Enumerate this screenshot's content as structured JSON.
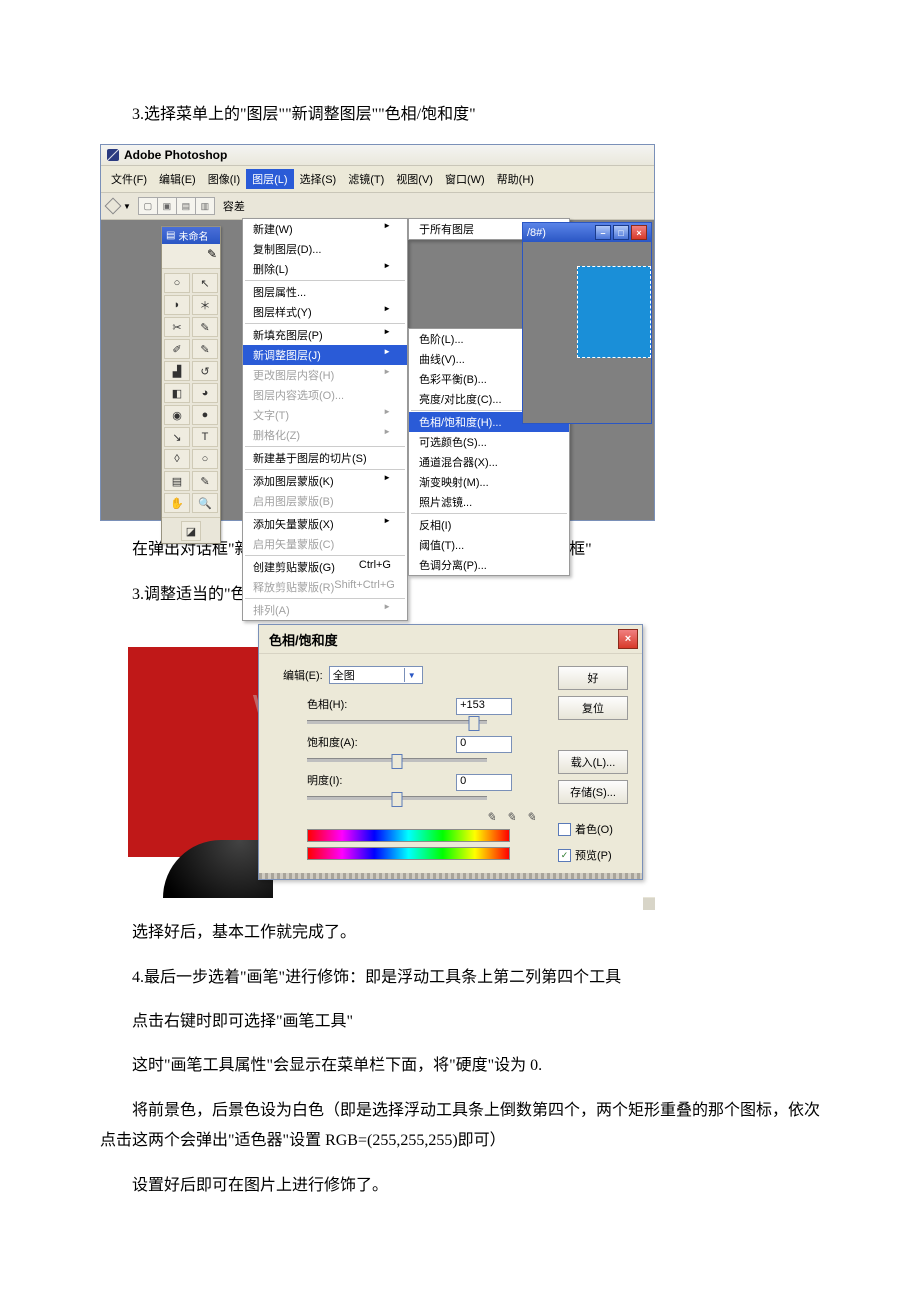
{
  "text": {
    "p1": "3.选择菜单上的\"图层\"\"新调整图层\"\"色相/饱和度\"",
    "p2": "在弹出对话框\"新建图层\"中点击\"好\"后，弹出\"色相/饱和度对话框\"",
    "p3": "3.调整适当的\"色相值\"即可",
    "p4": "选择好后，基本工作就完成了。",
    "p5": "4.最后一步选着\"画笔\"进行修饰：即是浮动工具条上第二列第四个工具",
    "p6": "点击右键时即可选择\"画笔工具\"",
    "p7": "这时\"画笔工具属性\"会显示在菜单栏下面，将\"硬度\"设为 0.",
    "p8": "将前景色，后景色设为白色（即是选择浮动工具条上倒数第四个，两个矩形重叠的那个图标，依次点击这两个会弹出\"适色器\"设置 RGB=(255,255,255)即可）",
    "p9": "设置好后即可在图片上进行修饰了。"
  },
  "ps": {
    "appTitle": "Adobe Photoshop",
    "menubar": [
      "文件(F)",
      "编辑(E)",
      "图像(I)",
      "图层(L)",
      "选择(S)",
      "滤镜(T)",
      "视图(V)",
      "窗口(W)",
      "帮助(H)"
    ],
    "optLabel": "容差",
    "toolsTitle": "未命名",
    "docTitle": "/8#)",
    "layerMenu": [
      {
        "t": "新建(W)",
        "arrow": true
      },
      {
        "t": "复制图层(D)..."
      },
      {
        "t": "删除(L)",
        "arrow": true
      },
      {
        "sep": true
      },
      {
        "t": "图层属性..."
      },
      {
        "t": "图层样式(Y)",
        "arrow": true
      },
      {
        "sep": true
      },
      {
        "t": "新填充图层(P)",
        "arrow": true
      },
      {
        "t": "新调整图层(J)",
        "arrow": true,
        "hl": true
      },
      {
        "t": "更改图层内容(H)",
        "disabled": true,
        "arrow": true
      },
      {
        "t": "图层内容选项(O)...",
        "disabled": true
      },
      {
        "t": "文字(T)",
        "disabled": true,
        "arrow": true
      },
      {
        "t": "删格化(Z)",
        "disabled": true,
        "arrow": true
      },
      {
        "sep": true
      },
      {
        "t": "新建基于图层的切片(S)"
      },
      {
        "sep": true
      },
      {
        "t": "添加图层蒙版(K)",
        "arrow": true
      },
      {
        "t": "启用图层蒙版(B)",
        "disabled": true
      },
      {
        "sep": true
      },
      {
        "t": "添加矢量蒙版(X)",
        "arrow": true
      },
      {
        "t": "启用矢量蒙版(C)",
        "disabled": true
      },
      {
        "sep": true
      },
      {
        "t": "创建剪贴蒙版(G)",
        "sc": "Ctrl+G"
      },
      {
        "t": "释放剪贴蒙版(R)",
        "sc": "Shift+Ctrl+G",
        "disabled": true
      },
      {
        "sep": true
      },
      {
        "t": "排列(A)",
        "arrow": true,
        "disabled": true
      }
    ],
    "matchAll": "于所有图层",
    "adjMenu1": [
      {
        "t": "色阶(L)..."
      },
      {
        "t": "曲线(V)..."
      },
      {
        "t": "色彩平衡(B)..."
      },
      {
        "t": "亮度/对比度(C)..."
      }
    ],
    "adjMenu2": [
      {
        "t": "色相/饱和度(H)...",
        "hl": true
      },
      {
        "t": "可选颜色(S)..."
      },
      {
        "t": "通道混合器(X)..."
      },
      {
        "t": "渐变映射(M)..."
      },
      {
        "t": "照片滤镜..."
      },
      {
        "sep": true
      },
      {
        "t": "反相(I)"
      },
      {
        "t": "阈值(T)..."
      },
      {
        "t": "色调分离(P)..."
      }
    ]
  },
  "hsl": {
    "title": "色相/饱和度",
    "editLbl": "编辑(E):",
    "editVal": "全图",
    "hueLbl": "色相(H):",
    "hueVal": "+153",
    "satLbl": "饱和度(A):",
    "satVal": "0",
    "ligLbl": "明度(I):",
    "ligVal": "0",
    "ok": "好",
    "reset": "复位",
    "load": "载入(L)...",
    "save": "存储(S)...",
    "colorize": "着色(O)",
    "preview": "预览(P)"
  },
  "watermark": "www.bdocx.com"
}
